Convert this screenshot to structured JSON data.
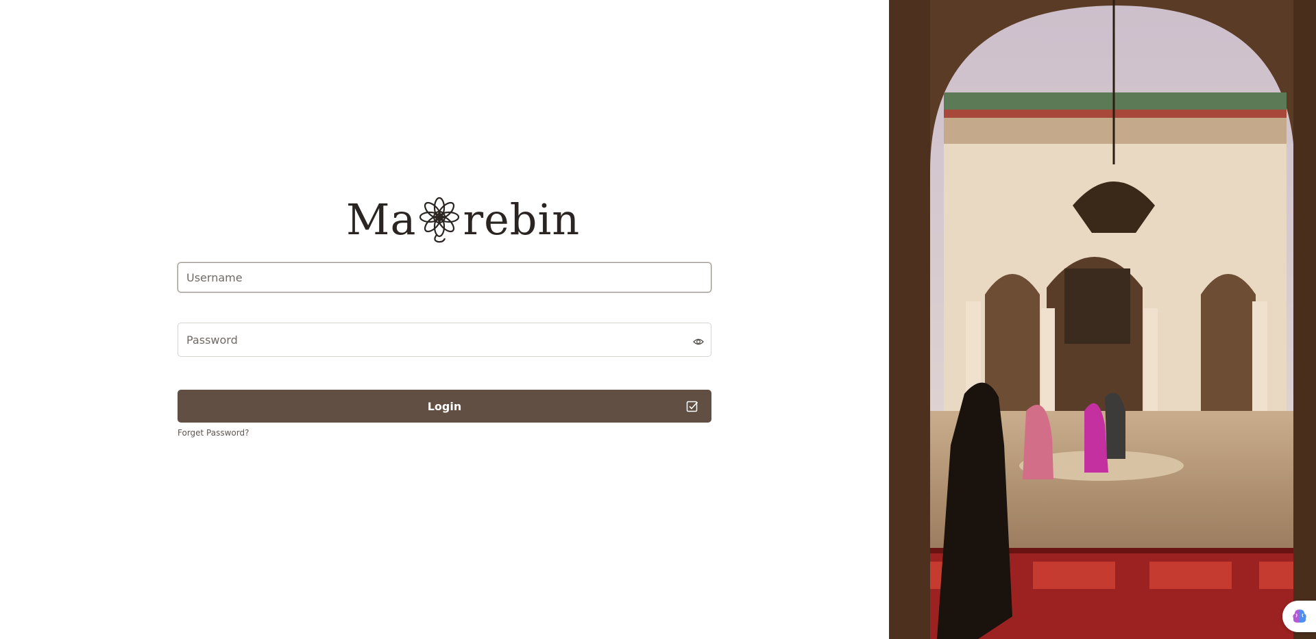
{
  "brand": {
    "logo_text_left": "Ma",
    "logo_text_right": "rebin",
    "logo_icon": "rosette-icon"
  },
  "login_form": {
    "username_placeholder": "Username",
    "password_placeholder": "Password",
    "show_password_icon": "eye-icon",
    "login_label": "Login",
    "login_icon": "checkbox-icon",
    "forgot_password_label": "Forget Password?"
  },
  "hero_image": {
    "subject": "courtyard photo"
  },
  "assistant": {
    "icon": "brain-icon"
  },
  "colors": {
    "primary_button": "#614f43",
    "background": "#ffffff",
    "text_dark": "#2a2522"
  }
}
